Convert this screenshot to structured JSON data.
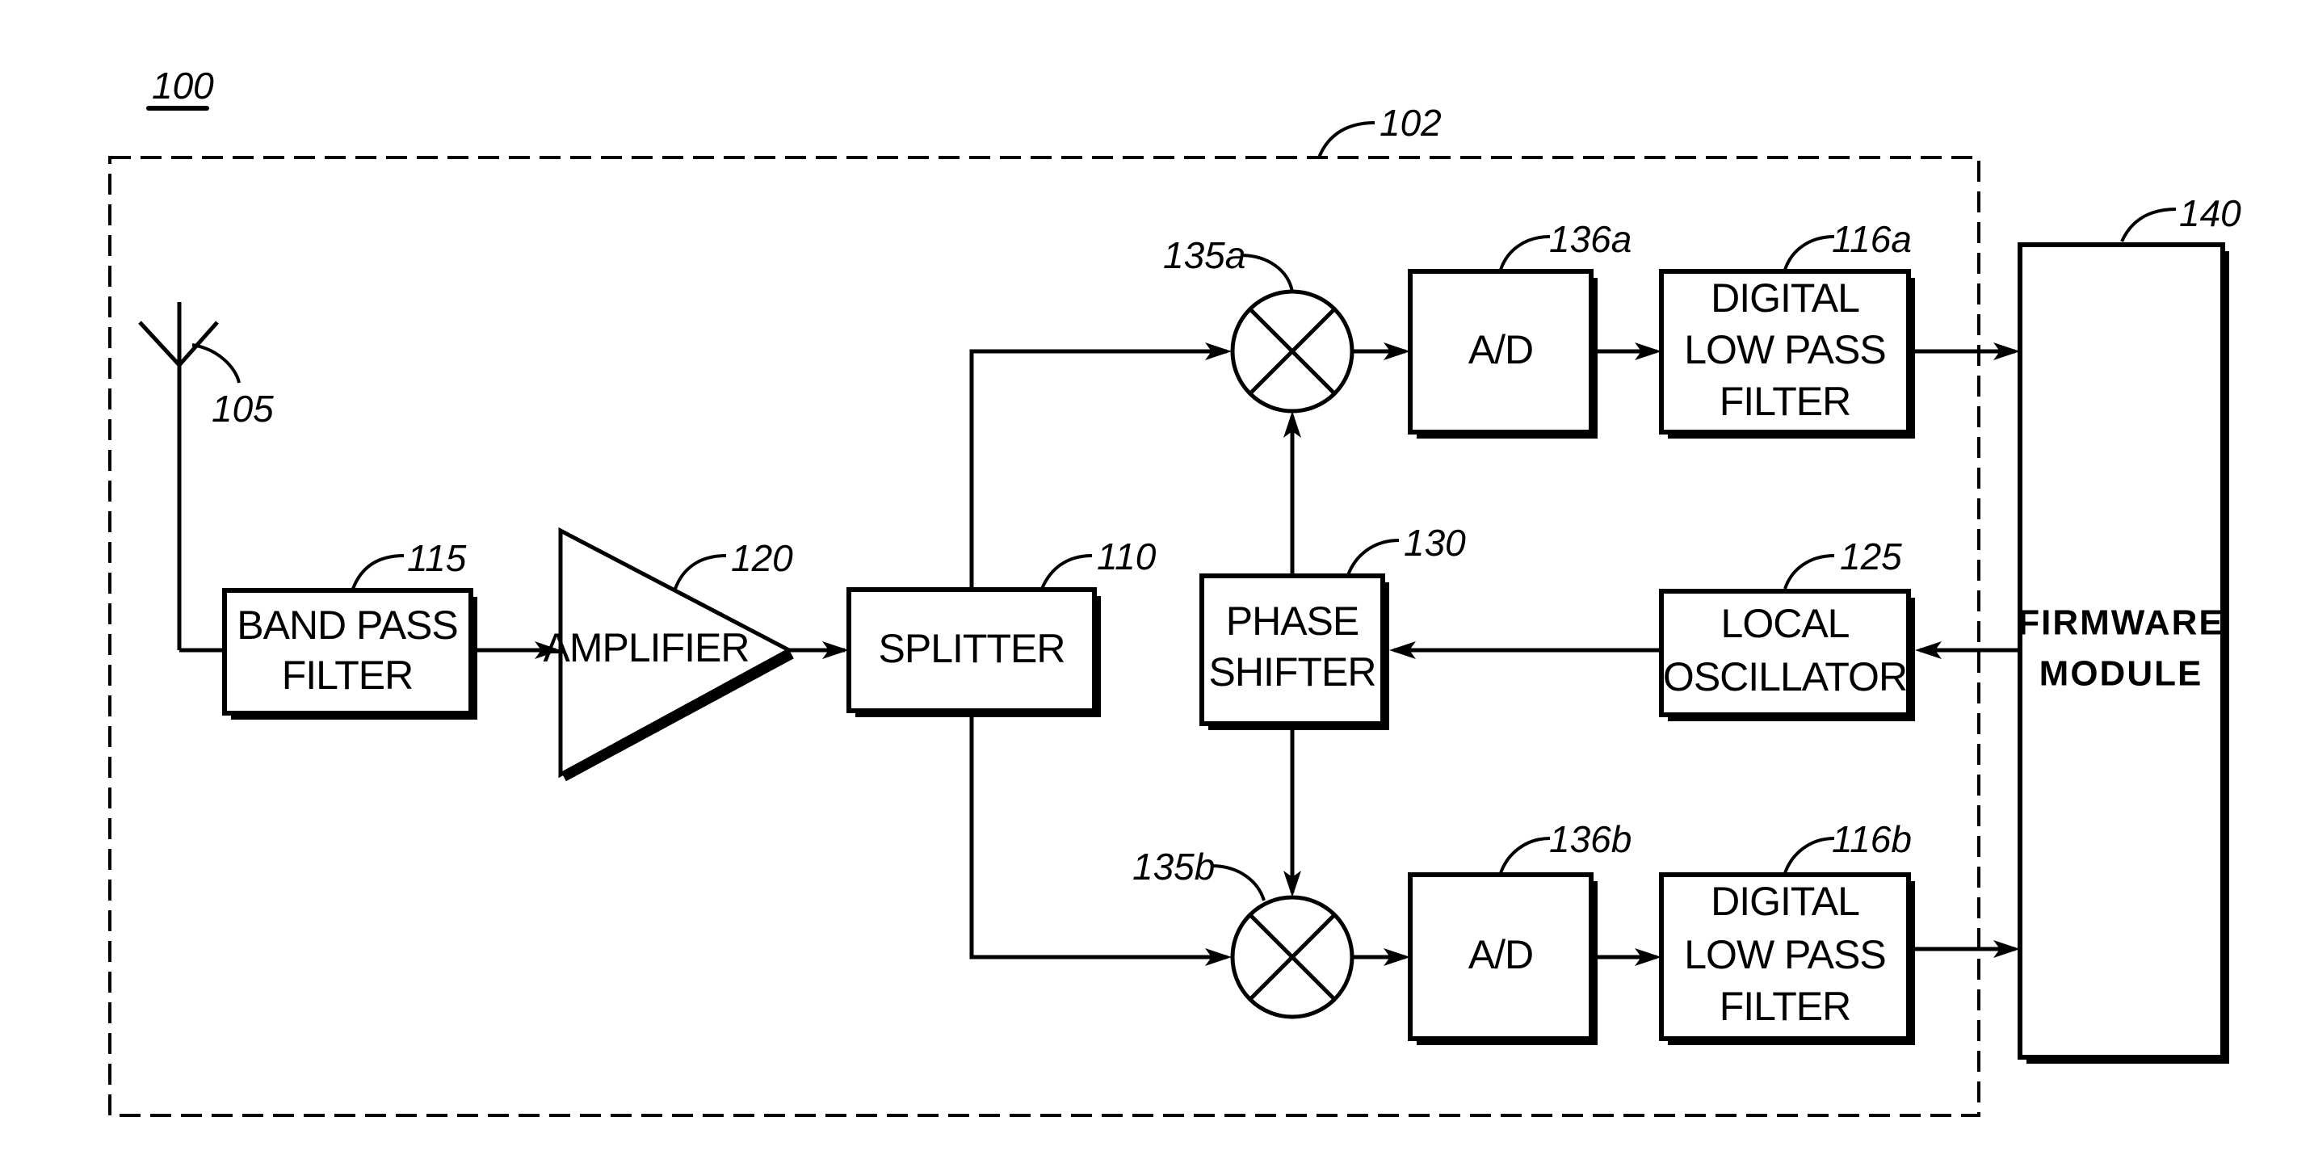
{
  "figure": {
    "number": "100",
    "enclosure_ref": "102"
  },
  "antenna": {
    "ref": "105"
  },
  "blocks": {
    "band_pass_filter": {
      "ref": "115",
      "lines": [
        "BAND PASS",
        "FILTER"
      ]
    },
    "amplifier": {
      "ref": "120",
      "lines": [
        "AMPLIFIER"
      ]
    },
    "splitter": {
      "ref": "110",
      "lines": [
        "SPLITTER"
      ]
    },
    "phase_shifter": {
      "ref": "130",
      "lines": [
        "PHASE",
        "SHIFTER"
      ]
    },
    "local_oscillator": {
      "ref": "125",
      "lines": [
        "LOCAL",
        "OSCILLATOR"
      ]
    },
    "mixer_a": {
      "ref": "135a"
    },
    "mixer_b": {
      "ref": "135b"
    },
    "ad_a": {
      "ref": "136a",
      "lines": [
        "A/D"
      ]
    },
    "ad_b": {
      "ref": "136b",
      "lines": [
        "A/D"
      ]
    },
    "dlpf_a": {
      "ref": "116a",
      "lines": [
        "DIGITAL",
        "LOW PASS",
        "FILTER"
      ]
    },
    "dlpf_b": {
      "ref": "116b",
      "lines": [
        "DIGITAL",
        "LOW PASS",
        "FILTER"
      ]
    },
    "firmware": {
      "ref": "140",
      "lines": [
        "FIRMWARE",
        "MODULE"
      ]
    }
  }
}
